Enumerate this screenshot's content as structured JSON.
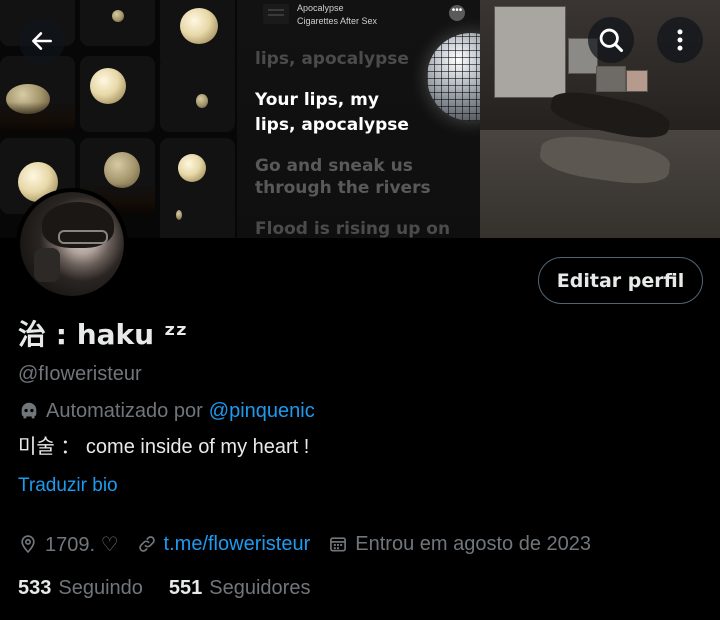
{
  "banner": {
    "song": {
      "title": "Apocalypse",
      "artist": "Cigarettes After Sex"
    },
    "lyrics": [
      {
        "text": "lips, apocalypse",
        "state": "faded"
      },
      {
        "text": "Your lips, my",
        "state": "active"
      },
      {
        "text": "lips, apocalypse",
        "state": "active"
      },
      {
        "text": "Go and sneak us",
        "state": "mid"
      },
      {
        "text": "through the rivers",
        "state": "mid"
      },
      {
        "text": "Flood is rising up on",
        "state": "faded"
      }
    ]
  },
  "header": {
    "back_icon": "arrow-left-icon",
    "search_icon": "search-icon",
    "more_icon": "more-vertical-icon"
  },
  "profile": {
    "edit_button": "Editar perfil",
    "name": "治 : haku ᶻᶻ",
    "handle": "@fIoweristeur",
    "automated_prefix": "Automatizado por",
    "automated_by": "@pinquenic",
    "bio": "미술 ： come inside of my heart !",
    "translate_label": "Traduzir bio",
    "location": "1709. ♡",
    "website": "t.me/floweristeur",
    "joined": "Entrou em agosto de 2023",
    "following_count": "533",
    "following_label": "Seguindo",
    "followers_count": "551",
    "followers_label": "Seguidores"
  },
  "colors": {
    "background": "#000000",
    "primary_text": "#e7e9ea",
    "secondary_text": "#71767b",
    "link": "#1d9bf0",
    "button_border": "#536471"
  }
}
